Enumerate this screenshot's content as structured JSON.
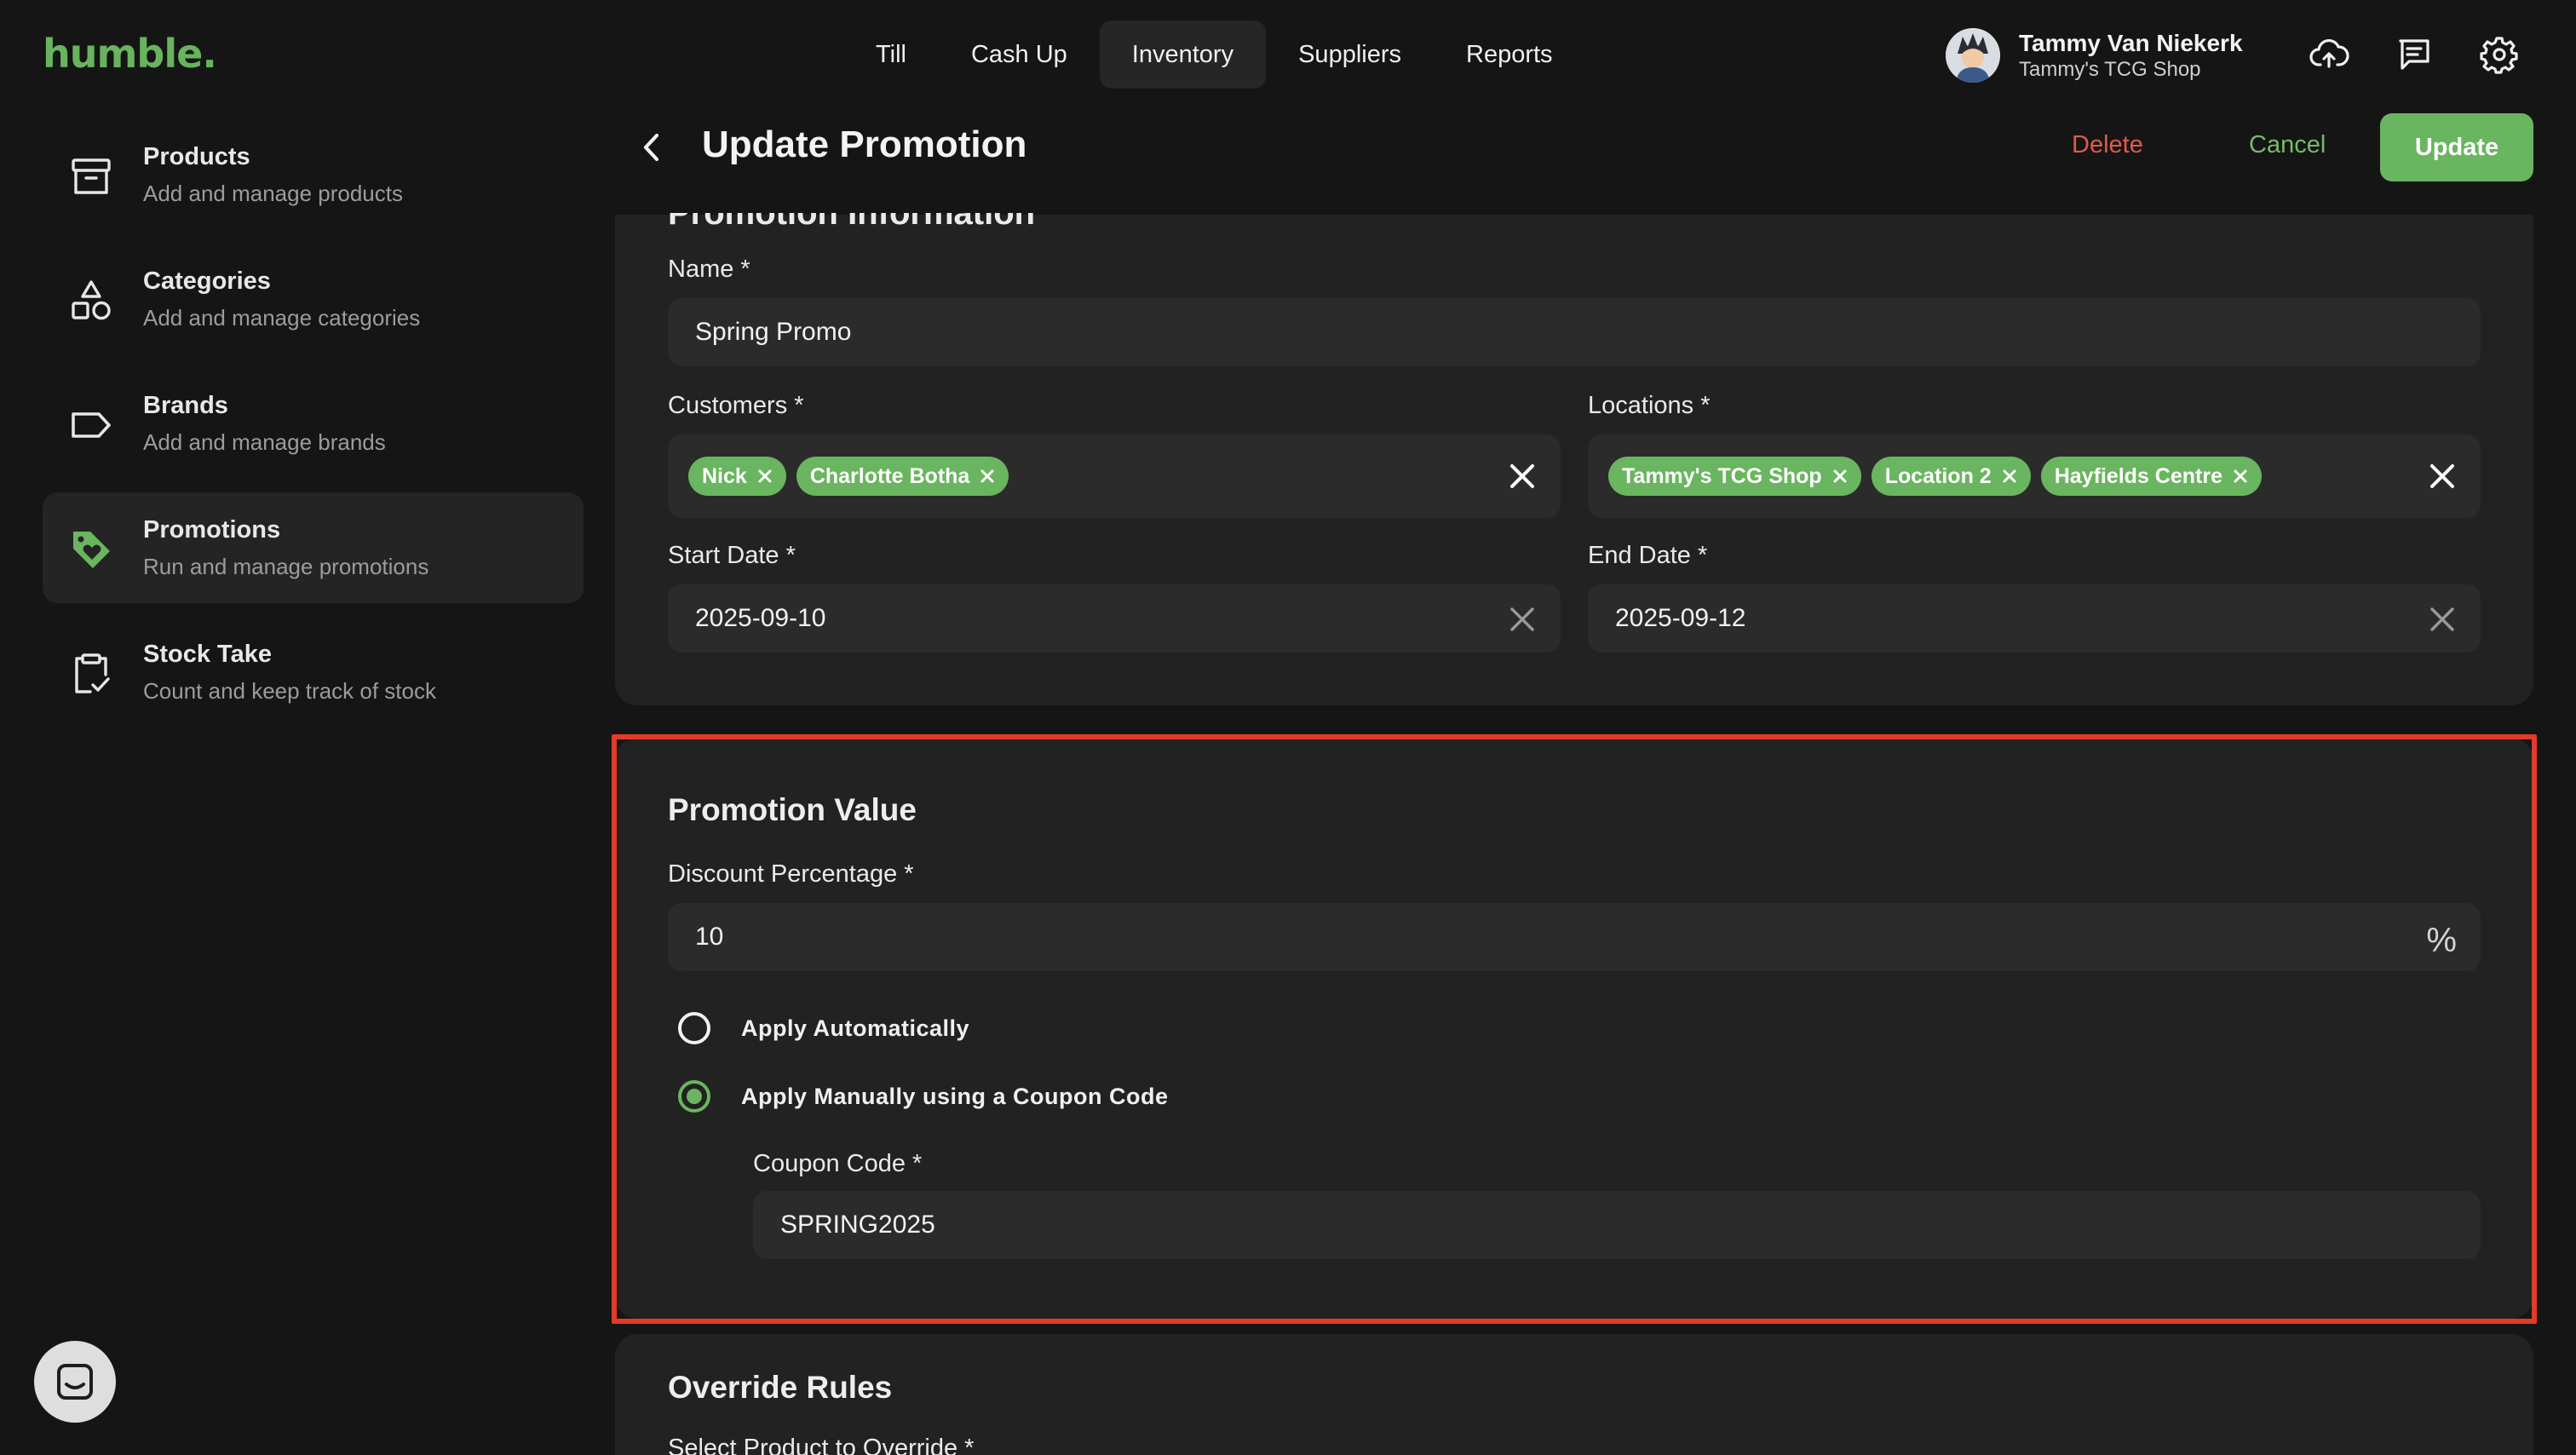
{
  "app": {
    "logo": "humble."
  },
  "nav": {
    "tabs": [
      {
        "label": "Till"
      },
      {
        "label": "Cash Up"
      },
      {
        "label": "Inventory",
        "active": true
      },
      {
        "label": "Suppliers"
      },
      {
        "label": "Reports"
      }
    ]
  },
  "profile": {
    "name": "Tammy Van Niekerk",
    "shop": "Tammy's TCG Shop"
  },
  "sidebar": {
    "items": [
      {
        "title": "Products",
        "subtitle": "Add and manage products",
        "icon": "archive-box-icon"
      },
      {
        "title": "Categories",
        "subtitle": "Add and manage categories",
        "icon": "shapes-icon"
      },
      {
        "title": "Brands",
        "subtitle": "Add and manage brands",
        "icon": "tag-outline-icon"
      },
      {
        "title": "Promotions",
        "subtitle": "Run and manage promotions",
        "icon": "tag-heart-icon",
        "active": true
      },
      {
        "title": "Stock Take",
        "subtitle": "Count and keep track of stock",
        "icon": "clipboard-check-icon"
      }
    ]
  },
  "header": {
    "title": "Update Promotion",
    "delete_label": "Delete",
    "cancel_label": "Cancel",
    "update_label": "Update"
  },
  "info": {
    "section_title_cut": "Promotion Information",
    "name_label": "Name *",
    "name_value": "Spring Promo",
    "customers_label": "Customers *",
    "customers": [
      "Nick",
      "Charlotte Botha"
    ],
    "locations_label": "Locations *",
    "locations": [
      "Tammy's TCG Shop",
      "Location 2",
      "Hayfields Centre"
    ],
    "start_label": "Start Date *",
    "start_value": "2025-09-10",
    "end_label": "End Date *",
    "end_value": "2025-09-12"
  },
  "value": {
    "section_title": "Promotion Value",
    "discount_label": "Discount Percentage *",
    "discount_value": "10",
    "percent_symbol": "%",
    "option_auto": "Apply Automatically",
    "option_manual": "Apply Manually using a Coupon Code",
    "selected_option": "manual",
    "coupon_label": "Coupon Code *",
    "coupon_value": "SPRING2025"
  },
  "override": {
    "section_title": "Override Rules",
    "product_label": "Select Product to Override *"
  },
  "colors": {
    "accent": "#6ab55f",
    "danger": "#e35a4a",
    "highlight": "#e23c28",
    "background": "#151515",
    "card": "#222222"
  }
}
